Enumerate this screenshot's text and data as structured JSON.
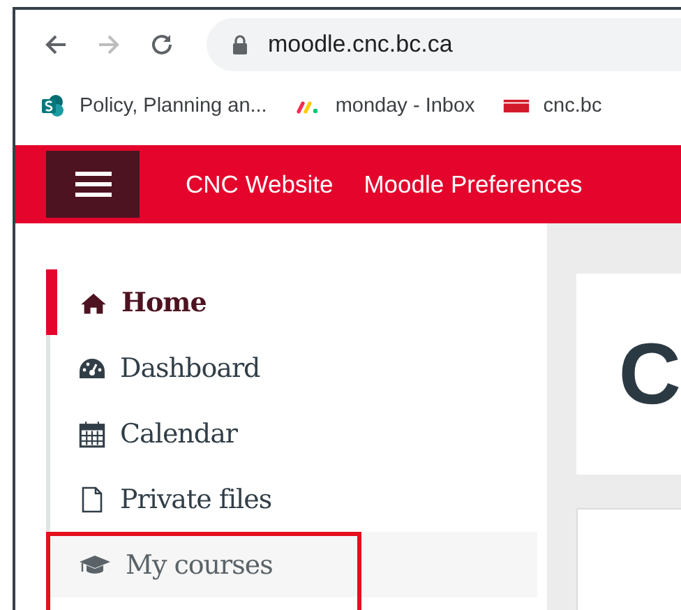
{
  "browser": {
    "url": "moodle.cnc.bc.ca",
    "bookmarks": [
      {
        "kind": "sharepoint",
        "label": "Policy, Planning an..."
      },
      {
        "kind": "monday",
        "label": "monday - Inbox"
      },
      {
        "kind": "cnc",
        "label": "cnc.bc"
      }
    ]
  },
  "navbar": {
    "links": [
      "CNC Website",
      "Moodle Preferences"
    ]
  },
  "sidebar": {
    "items": [
      {
        "kind": "home",
        "label": "Home",
        "selected": true,
        "highlighted": false
      },
      {
        "kind": "dashboard",
        "label": "Dashboard",
        "selected": false,
        "highlighted": false
      },
      {
        "kind": "calendar",
        "label": "Calendar",
        "selected": false,
        "highlighted": false
      },
      {
        "kind": "file",
        "label": "Private files",
        "selected": false,
        "highlighted": false
      },
      {
        "kind": "courses",
        "label": "My courses",
        "selected": false,
        "highlighted": true
      }
    ]
  },
  "main": {
    "heading": "C"
  }
}
